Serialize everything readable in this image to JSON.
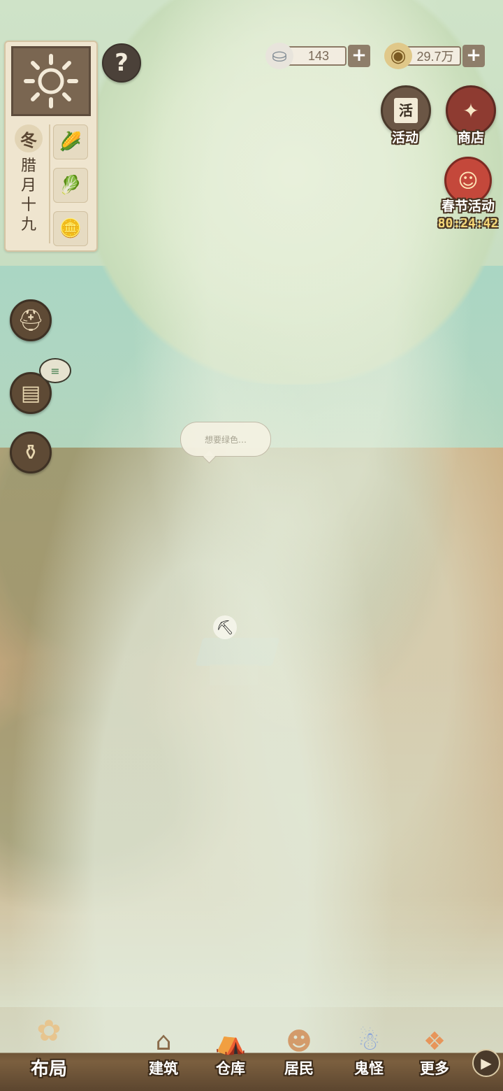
{
  "calendar": {
    "season": "冬",
    "date_lines": [
      "腊",
      "月",
      "十",
      "九"
    ],
    "items": [
      {
        "icon": "corn-icon",
        "glyph": "🌽"
      },
      {
        "icon": "cabbage-icon",
        "glyph": "🥬"
      },
      {
        "icon": "ingot-icon",
        "glyph": "🪙"
      }
    ]
  },
  "currencies": {
    "silver": {
      "value": "143",
      "icon": "silver-ingot-icon"
    },
    "coins": {
      "value": "29.7万",
      "icon": "copper-coin-icon"
    }
  },
  "right_buttons": {
    "activity": {
      "label": "活动",
      "badge": "活"
    },
    "shop": {
      "label": "商店"
    },
    "spring_festival": {
      "label": "春节活动",
      "timer": "80:24:42"
    }
  },
  "bubble_text": "想要绿色…",
  "bottom_nav": {
    "layout": "布局",
    "build": "建筑",
    "warehouse": "仓库",
    "residents": "居民",
    "ghosts": "鬼怪",
    "more": "更多"
  },
  "colors": {
    "panel_bg": "#efe5cf",
    "panel_dark": "#7a6651",
    "nav_bar": "#6e5437",
    "timer": "#f6d776"
  }
}
